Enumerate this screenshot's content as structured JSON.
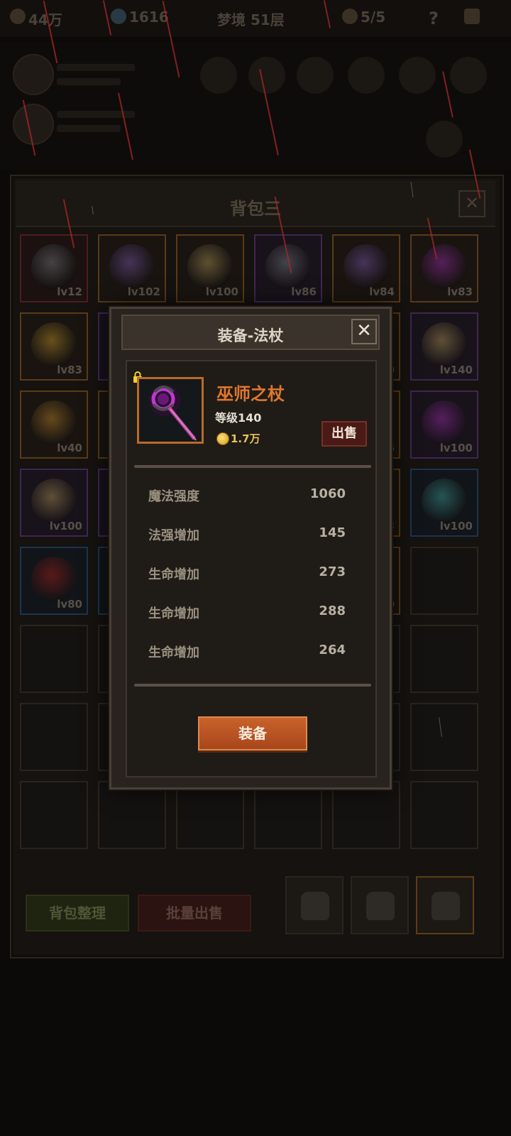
{
  "topbar": {
    "gold": "44万",
    "gems": "1616",
    "dungeon": "梦境 51层",
    "energy": "5/5",
    "help": "?"
  },
  "bag": {
    "title": "背包三",
    "close": "✕",
    "rows": [
      [
        {
          "lv": "lv12",
          "q": "q-red",
          "icon": "ring-icon",
          "color": "#7a7e84"
        },
        {
          "lv": "lv102",
          "q": "q-orange",
          "icon": "sword-icon",
          "color": "#7e5ab0"
        },
        {
          "lv": "lv100",
          "q": "q-orange",
          "icon": "ring-icon",
          "color": "#b59a5a"
        },
        {
          "lv": "lv86",
          "q": "q-purple",
          "icon": "armor-icon",
          "color": "#7a8086"
        },
        {
          "lv": "lv84",
          "q": "q-orange",
          "icon": "sword-icon",
          "color": "#7e5ab0"
        },
        {
          "lv": "lv83",
          "q": "q-orange",
          "icon": "staff-icon",
          "color": "#a02fb0"
        }
      ],
      [
        {
          "lv": "lv83",
          "q": "q-orange",
          "icon": "amulet-icon",
          "color": "#c79a2a"
        },
        {
          "lv": "",
          "q": "q-purple",
          "icon": "",
          "color": ""
        },
        {
          "lv": "",
          "q": "",
          "icon": "",
          "color": ""
        },
        {
          "lv": "",
          "q": "",
          "icon": "",
          "color": ""
        },
        {
          "lv": "0",
          "q": "q-orange",
          "icon": "",
          "color": ""
        },
        {
          "lv": "lv140",
          "q": "q-purple",
          "icon": "ring-icon",
          "color": "#b59a5a"
        }
      ],
      [
        {
          "lv": "lv40",
          "q": "q-orange",
          "icon": "ring-icon",
          "color": "#c2892a"
        },
        {
          "lv": "",
          "q": "q-orange",
          "icon": "",
          "color": ""
        },
        {
          "lv": "",
          "q": "",
          "icon": "",
          "color": ""
        },
        {
          "lv": "",
          "q": "",
          "icon": "",
          "color": ""
        },
        {
          "lv": "6",
          "q": "q-orange",
          "icon": "",
          "color": ""
        },
        {
          "lv": "lv100",
          "q": "q-purple",
          "icon": "staff-icon",
          "color": "#a02fb0"
        }
      ],
      [
        {
          "lv": "lv100",
          "q": "q-purple",
          "icon": "ring-icon",
          "color": "#b59a5a"
        },
        {
          "lv": "",
          "q": "q-purple",
          "icon": "",
          "color": ""
        },
        {
          "lv": "",
          "q": "",
          "icon": "",
          "color": ""
        },
        {
          "lv": "",
          "q": "",
          "icon": "",
          "color": ""
        },
        {
          "lv": "3",
          "q": "q-orange",
          "icon": "",
          "color": ""
        },
        {
          "lv": "lv100",
          "q": "q-blue",
          "icon": "orb-icon",
          "color": "#3fa3a0"
        }
      ],
      [
        {
          "lv": "lv80",
          "q": "q-blue",
          "icon": "pendant-icon",
          "color": "#b01e1e"
        },
        {
          "lv": "",
          "q": "q-blue",
          "icon": "",
          "color": ""
        },
        {
          "lv": "",
          "q": "",
          "icon": "",
          "color": ""
        },
        {
          "lv": "",
          "q": "",
          "icon": "",
          "color": ""
        },
        {
          "lv": "0",
          "q": "q-orange",
          "icon": "",
          "color": ""
        },
        {
          "lv": "",
          "q": "",
          "icon": "",
          "color": ""
        }
      ]
    ],
    "sort_label": "背包整理",
    "batch_sell_label": "批量出售"
  },
  "modal": {
    "title": "装备-法杖",
    "close": "✕",
    "item_name": "巫师之杖",
    "level": "等级140",
    "price": "1.7万",
    "sell_label": "出售",
    "stats": [
      {
        "name": "魔法强度",
        "value": "1060"
      },
      {
        "name": "法强增加",
        "value": "145"
      },
      {
        "name": "生命增加",
        "value": "273"
      },
      {
        "name": "生命增加",
        "value": "288"
      },
      {
        "name": "生命增加",
        "value": "264"
      }
    ],
    "equip_label": "装备",
    "colors": {
      "name": "#e0772c",
      "accent": "#c9622a",
      "price": "#e8c35a"
    }
  }
}
